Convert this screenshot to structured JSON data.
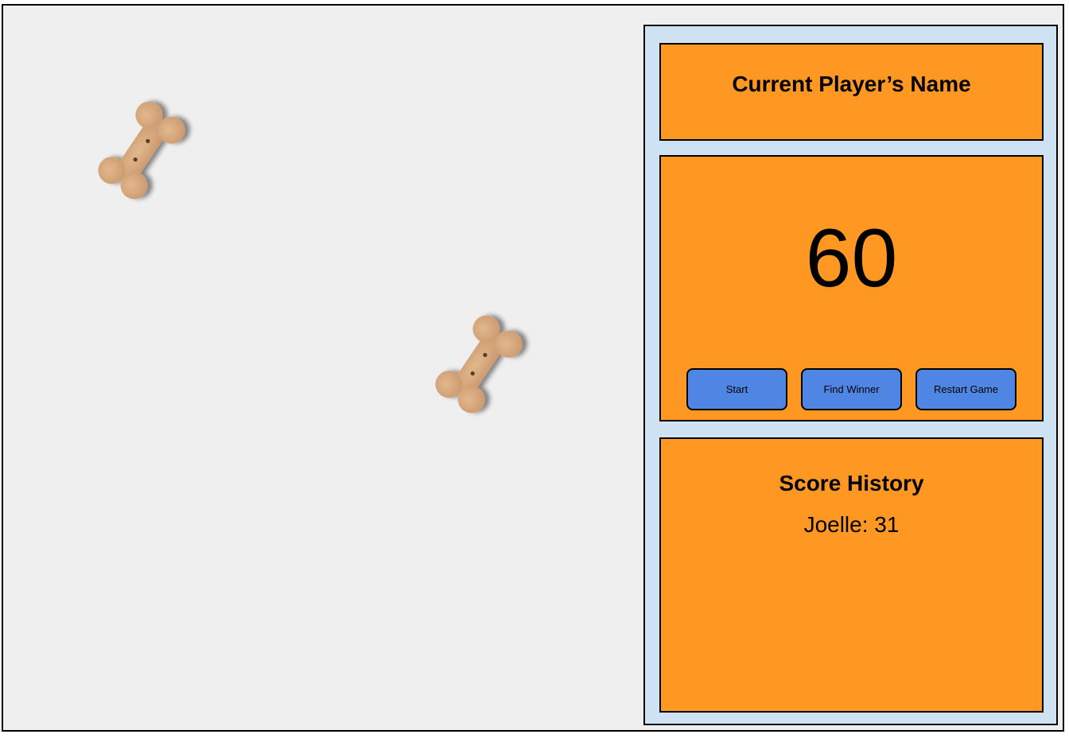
{
  "game": {
    "bones": [
      {
        "icon": "dog-bone-biscuit-icon"
      },
      {
        "icon": "dog-bone-biscuit-icon"
      }
    ]
  },
  "panel": {
    "player_name": "Current Player’s Name",
    "timer": "60",
    "buttons": {
      "start": "Start",
      "find_winner": "Find Winner",
      "restart": "Restart Game"
    },
    "history": {
      "title": "Score History",
      "entries": [
        {
          "text": "Joelle: 31"
        }
      ]
    }
  },
  "colors": {
    "stage_background": "#efefef",
    "panel_background": "#cfe2f3",
    "card_background": "#ff9823",
    "button_background": "#4f86e3",
    "bone_color": "#d9a878"
  }
}
